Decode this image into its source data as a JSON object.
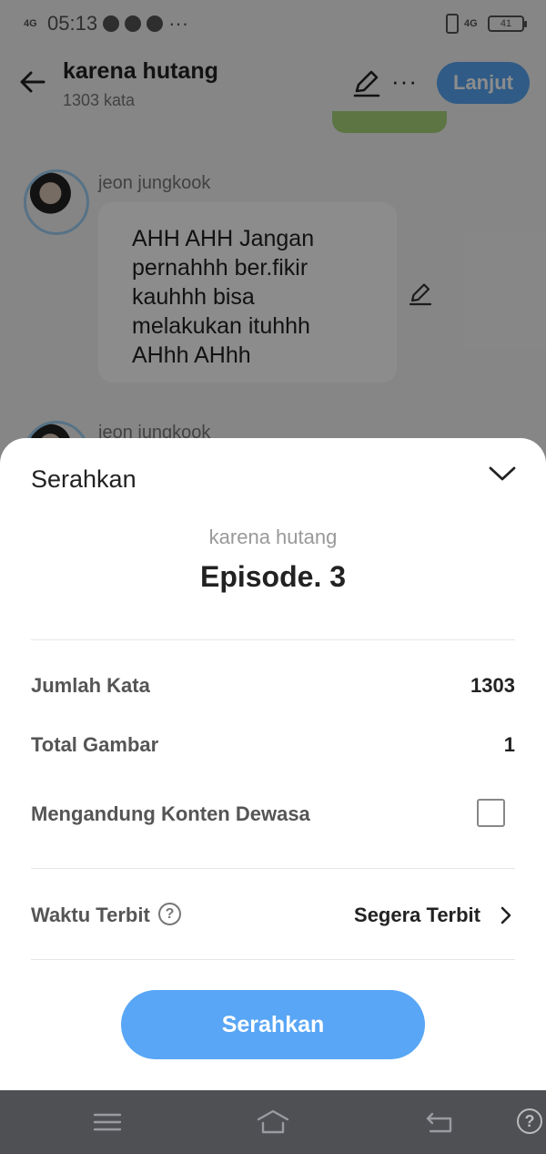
{
  "status_bar": {
    "network": "4G",
    "time": "05:13",
    "more": "···",
    "network_right": "4G",
    "battery": "41"
  },
  "header": {
    "title": "karena hutang",
    "word_count": "1303 kata",
    "next_label": "Lanjut",
    "more_label": "···"
  },
  "chat": {
    "messages": [
      {
        "sender": "jeon jungkook",
        "text": "AHH AHH Jangan pernahhh ber.fikir kauhhh bisa melakukan ituhhh AHhh AHhh"
      },
      {
        "sender": "jeon jungkook",
        "text": ""
      }
    ]
  },
  "sheet": {
    "title": "Serahkan",
    "story_title": "karena hutang",
    "episode": "Episode. 3",
    "rows": [
      {
        "label": "Jumlah Kata",
        "value": "1303"
      },
      {
        "label": "Total Gambar",
        "value": "1"
      },
      {
        "label": "Mengandung Konten Dewasa",
        "checked": false
      },
      {
        "label": "Waktu Terbit",
        "value": "Segera Terbit",
        "help": "?"
      }
    ],
    "submit_label": "Serahkan"
  },
  "nav": {
    "help": "?"
  },
  "colors": {
    "accent": "#58a6f5",
    "navbar": "#4f5054",
    "green_bubble": "#a8d67a"
  },
  "icons": [
    "back-arrow-icon",
    "pencil-icon",
    "more-icon",
    "chevron-down-icon",
    "help-icon",
    "chevron-right-icon",
    "menu-icon",
    "home-icon",
    "back-nav-icon"
  ]
}
